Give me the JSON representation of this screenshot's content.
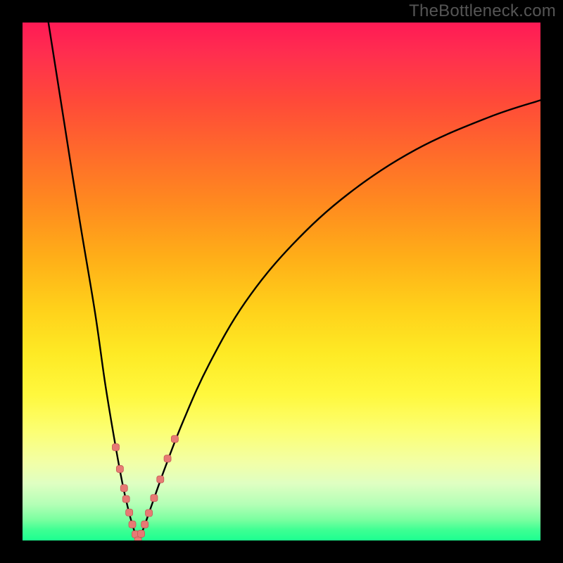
{
  "watermark": {
    "text": "TheBottleneck.com"
  },
  "colors": {
    "frame": "#000000",
    "curve": "#000000",
    "marker_fill": "#e77a74",
    "marker_stroke": "#c45a55"
  },
  "chart_data": {
    "type": "line",
    "title": "",
    "xlabel": "",
    "ylabel": "",
    "xlim": [
      0,
      100
    ],
    "ylim": [
      0,
      100
    ],
    "grid": false,
    "legend": false,
    "notes": "V-shaped bottleneck curve. X is relative component performance; Y is bottleneck severity (0 = no bottleneck, 100 = max). Minimum near x≈22. Left branch steep; right branch asymptotically rises. Background vertical gradient maps Y to color: green low, red high. Pink markers cluster near the valley on both branches.",
    "series": [
      {
        "name": "left_branch",
        "x": [
          5,
          8,
          11,
          14,
          16,
          18,
          19.5,
          20.8,
          21.7,
          22.3
        ],
        "y": [
          100,
          81,
          62,
          44,
          30,
          18,
          10,
          4.5,
          1.5,
          0
        ]
      },
      {
        "name": "right_branch",
        "x": [
          22.3,
          23.3,
          25,
          27.5,
          31,
          36,
          43,
          52,
          63,
          76,
          90,
          100
        ],
        "y": [
          0,
          2.2,
          7,
          14,
          23,
          34,
          46,
          57,
          67,
          75.5,
          81.7,
          85
        ]
      }
    ],
    "markers": {
      "name": "highlighted_points",
      "x": [
        18.0,
        18.8,
        19.6,
        20.0,
        20.6,
        21.2,
        21.8,
        22.3,
        22.9,
        23.6,
        24.4,
        25.4,
        26.6,
        28.0,
        29.4
      ],
      "y": [
        18.0,
        13.8,
        10.1,
        8.0,
        5.4,
        3.1,
        1.2,
        0.0,
        1.3,
        3.1,
        5.3,
        8.2,
        11.8,
        15.8,
        19.6
      ]
    }
  }
}
